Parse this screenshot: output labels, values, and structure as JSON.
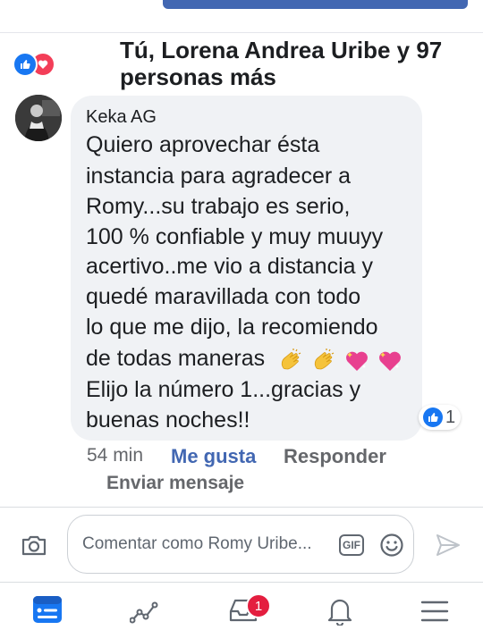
{
  "reactions": {
    "summary_line1": "Tú, Lorena Andrea Uribe y 97",
    "summary_line2": "personas más",
    "icons": [
      "like-icon",
      "love-icon"
    ]
  },
  "comment": {
    "author": "Keka AG",
    "lines": [
      "Quiero aprovechar ésta",
      "instancia para agradecer a",
      "Romy...su trabajo es serio,",
      "100 % confiable y muy muuyy",
      "acertivo..me vio a distancia y",
      "quedé maravillada con todo",
      "lo que me dijo, la recomiendo",
      "de todas maneras",
      "Elijo la número 1...gracias y",
      "buenas noches!!"
    ],
    "emojis": [
      "clapping-hands-emoji",
      "clapping-hands-emoji",
      "sparkling-heart-emoji",
      "sparkling-heart-emoji"
    ],
    "like_count": "1",
    "time": "54 min",
    "like_label": "Me gusta",
    "reply_label": "Responder",
    "send_message_label": "Enviar mensaje"
  },
  "composer": {
    "placeholder": "Comentar como Romy Uribe...",
    "gif_label": "GIF"
  },
  "nav": {
    "items": [
      "news-feed-icon",
      "activity-icon",
      "notifications-tray-icon",
      "bell-icon",
      "menu-icon"
    ],
    "badge": "1"
  },
  "colors": {
    "accent": "#4267b2",
    "like": "#1877f2",
    "love": "#f33e58",
    "badge": "#e41e3f"
  }
}
